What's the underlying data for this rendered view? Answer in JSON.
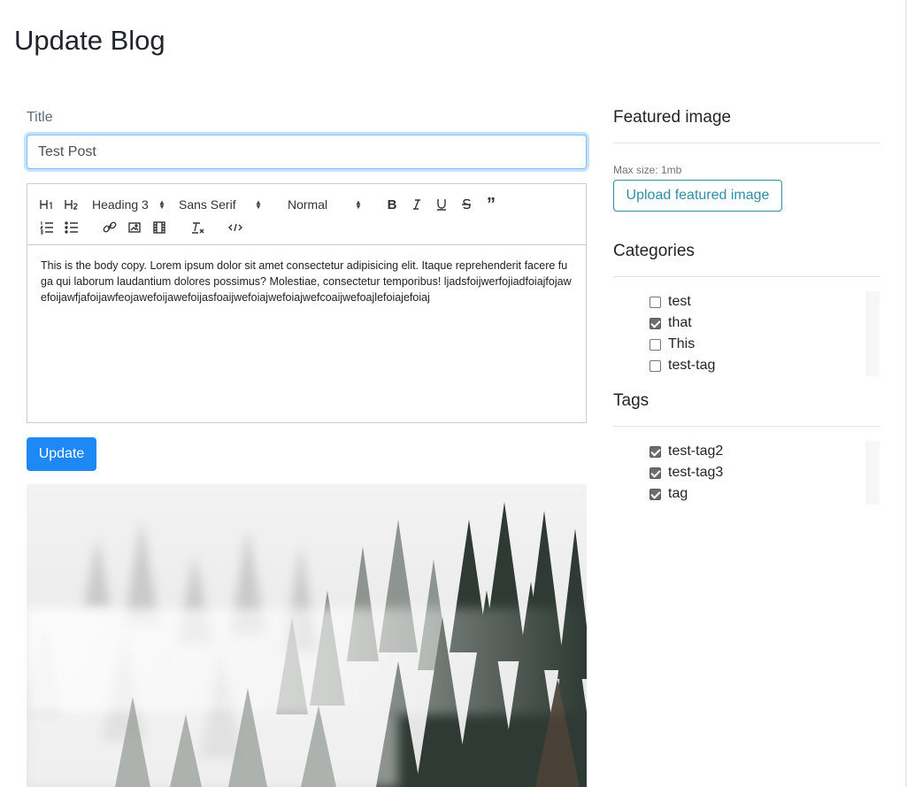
{
  "page": {
    "title": "Update Blog"
  },
  "form": {
    "title_label": "Title",
    "title_value": "Test Post",
    "update_label": "Update"
  },
  "toolbar": {
    "heading_select": "Heading 3",
    "font_select": "Sans Serif",
    "size_select": "Normal",
    "icons": [
      "h1-icon",
      "h2-icon",
      "bold-icon",
      "italic-icon",
      "underline-icon",
      "strike-icon",
      "blockquote-icon",
      "ordered-list-icon",
      "bullet-list-icon",
      "link-icon",
      "image-icon",
      "video-icon",
      "clean-format-icon",
      "code-block-icon"
    ]
  },
  "editor": {
    "body": "This is the body copy. Lorem ipsum dolor sit amet consectetur adipisicing elit. Itaque reprehenderit facere fuga qui laborum laudantium dolores possimus? Molestiae, consectetur temporibus! ljadsfoijwerfojiadfoiajfojawefoijawfjafoijawfeojawefoijawefoijasfoaijwefoiajwefoiajwefcoaijwefoajlefoiajefoiaj"
  },
  "sidebar": {
    "featured": {
      "heading": "Featured image",
      "max_size": "Max size: 1mb",
      "upload_label": "Upload featured image"
    },
    "categories": {
      "heading": "Categories",
      "items": [
        {
          "label": "test",
          "checked": false
        },
        {
          "label": "that",
          "checked": true
        },
        {
          "label": "This",
          "checked": false
        },
        {
          "label": "test-tag",
          "checked": false
        }
      ]
    },
    "tags": {
      "heading": "Tags",
      "items": [
        {
          "label": "test-tag2",
          "checked": true
        },
        {
          "label": "test-tag3",
          "checked": true
        },
        {
          "label": "tag",
          "checked": true
        }
      ]
    }
  },
  "colors": {
    "primary": "#1e88f5",
    "info": "#2f8fa5",
    "focus": "#80bdff"
  }
}
